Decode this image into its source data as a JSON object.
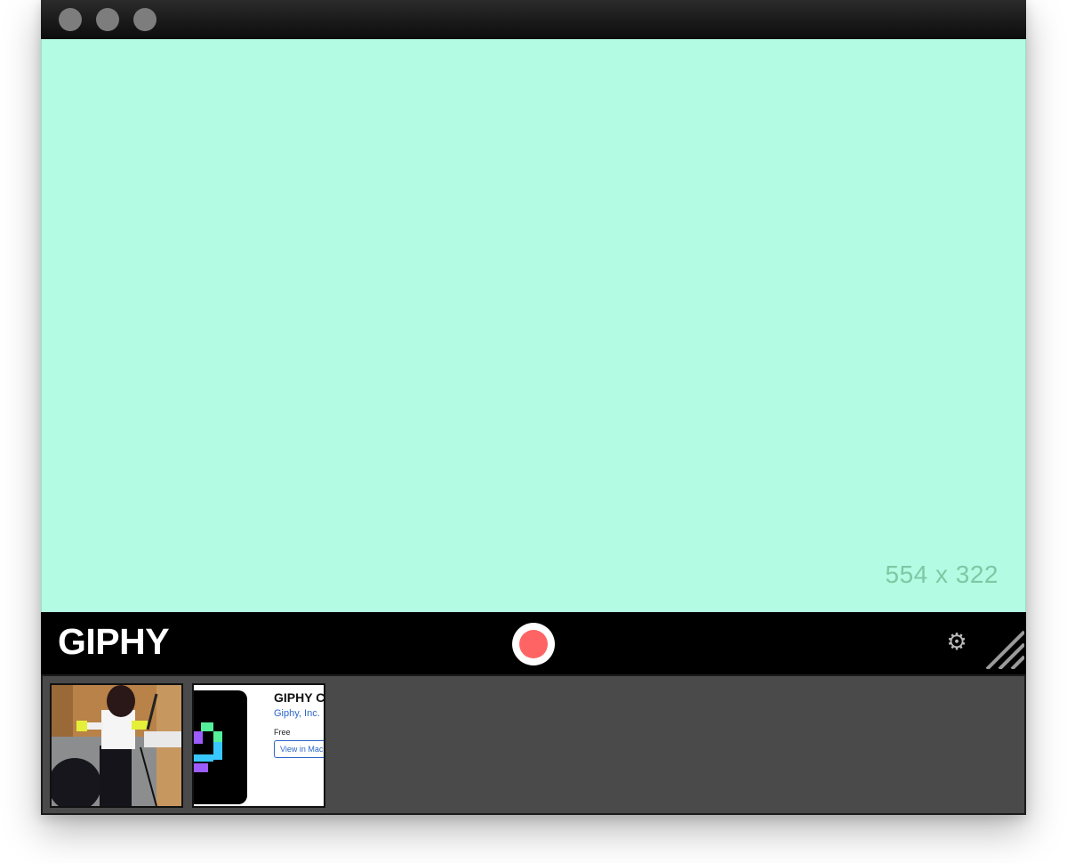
{
  "window": {
    "buttons": [
      "close",
      "minimize",
      "zoom"
    ]
  },
  "capture_area": {
    "dimensions_label": "554 x 322",
    "background_color": "#b3fbe2"
  },
  "toolbar": {
    "logo": "GIPHY",
    "record_icon": "record-icon",
    "settings_icon": "gear-icon",
    "resize_icon": "resize-handle-icon",
    "record_color": "#ff6464"
  },
  "tray": {
    "thumbnails": [
      {
        "type": "photo"
      },
      {
        "type": "app-store",
        "title": "GIPHY C",
        "publisher": "Giphy, Inc.",
        "price": "Free",
        "button": "View in Mac"
      }
    ]
  }
}
